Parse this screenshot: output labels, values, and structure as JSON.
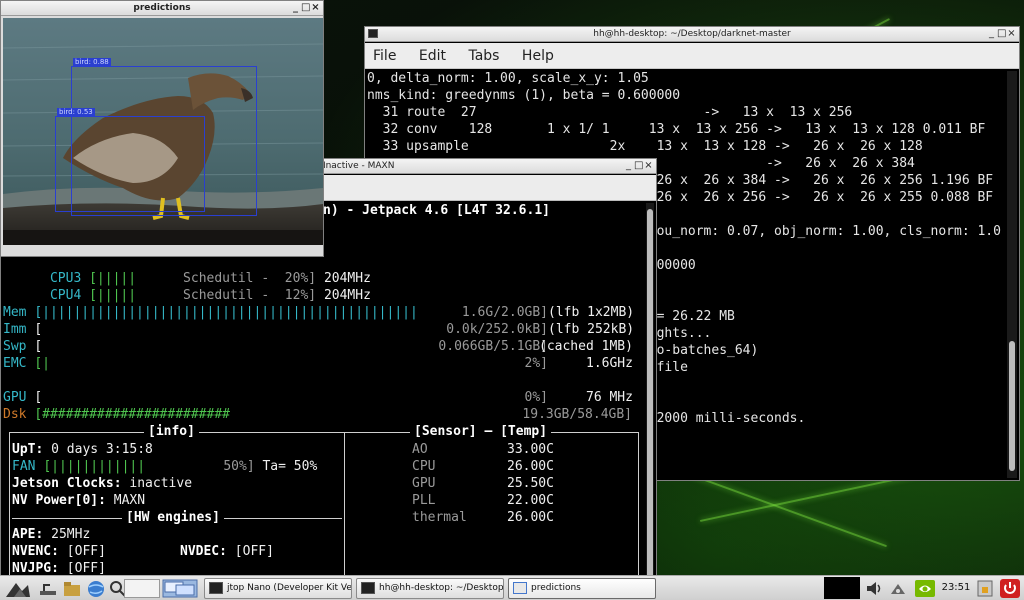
{
  "terminal": {
    "title": "hh@hh-desktop: ~/Desktop/darknet-master",
    "menu": [
      "File",
      "Edit",
      "Tabs",
      "Help"
    ],
    "lines": [
      "0, delta_norm: 1.00, scale_x_y: 1.05",
      "nms_kind: greedynms (1), beta = 0.600000",
      "  31 route  27                             ->   13 x  13 x 256",
      "  32 conv    128       1 x 1/ 1     13 x  13 x 256 ->   13 x  13 x 128 0.011 BF",
      "  33 upsample                  2x    13 x  13 x 128 ->   26 x  26 x 128",
      "                                                   ->   26 x  26 x 384",
      "                                     26 x  26 x 384 ->   26 x  26 x 256 1.196 BF",
      "                                     26 x  26 x 256 ->   26 x  26 x 255 0.088 BF",
      "",
      "                                     ou_norm: 0.07, obj_norm: 1.00, cls_norm: 1.0",
      "",
      "                                     00000",
      "",
      "",
      "                                     = 26.22 MB",
      "                                     ghts...",
      "                                     o-batches_64)",
      "                                     file",
      "",
      "",
      "                                     2000 milli-seconds."
    ]
  },
  "jtop": {
    "title": "jtop Nano (Developer Kit Version) - JC: Inactive - MAXN",
    "title_visible": "Version) - JC: Inactive - MAXN",
    "header": "n) - Jetpack 4.6 [L4T 32.6.1]",
    "cpus": [
      {
        "label": "CPU3",
        "bar": "[|||||",
        "gov": "Schedutil -",
        "pct": "20%]",
        "freq": "204MHz"
      },
      {
        "label": "CPU4",
        "bar": "[|||||",
        "gov": "Schedutil -",
        "pct": "12%]",
        "freq": "204MHz"
      }
    ],
    "mem": [
      {
        "label": "Mem",
        "bar": "[||||||||||||||||||||||||||||||||||||||||||||||||",
        "value": "1.6G/2.0GB]",
        "extra": "(lfb 1x2MB)"
      },
      {
        "label": "Imm",
        "bar": "[",
        "value": "0.0k/252.0kB]",
        "extra": "(lfb 252kB)"
      },
      {
        "label": "Swp",
        "bar": "[",
        "value": "0.066GB/5.1GB]",
        "extra": "(cached 1MB)"
      },
      {
        "label": "EMC",
        "bar": "[|",
        "value": "2%]",
        "extra": "1.6GHz"
      }
    ],
    "gpu": {
      "label": "GPU",
      "bar": "[",
      "value": "0%]",
      "extra": "76 MHz"
    },
    "dsk": {
      "label": "Dsk",
      "bar": "[########################",
      "value": "19.3GB/58.4GB]"
    },
    "info": {
      "title": "[info]",
      "uptime_label": "UpT:",
      "uptime": "0 days 3:15:8",
      "fan_label": "FAN",
      "fan_bar": "[||||||||||||",
      "fan_pct": "50%]",
      "fan_ta": "Ta= 50%",
      "clocks_label": "Jetson Clocks:",
      "clocks": "inactive",
      "nvpower_label": "NV Power[0]:",
      "nvpower": "MAXN"
    },
    "hw": {
      "title": "[HW engines]",
      "ape_label": "APE:",
      "ape": "25MHz",
      "nvenc_label": "NVENC:",
      "nvenc": "[OFF]",
      "nvdec_label": "NVDEC:",
      "nvdec": "[OFF]",
      "nvjpg_label": "NVJPG:",
      "nvjpg": "[OFF]"
    },
    "sensor": {
      "title_sensor": "[Sensor]",
      "title_temp": "[Temp]",
      "rows": [
        {
          "name": "AO",
          "temp": "33.00C"
        },
        {
          "name": "CPU",
          "temp": "26.00C"
        },
        {
          "name": "GPU",
          "temp": "25.50C"
        },
        {
          "name": "PLL",
          "temp": "22.00C"
        },
        {
          "name": "thermal",
          "temp": "26.00C"
        }
      ]
    }
  },
  "predictions": {
    "title": "predictions",
    "detections": [
      {
        "label": "bird: 0.88"
      },
      {
        "label": "bird: 0.53"
      }
    ]
  },
  "taskbar": {
    "tasks": [
      {
        "label": "jtop Nano (Developer Kit Ver..."
      },
      {
        "label": "hh@hh-desktop: ~/Desktop/..."
      },
      {
        "label": "predictions"
      }
    ],
    "clock": "23:51"
  },
  "colors": {
    "jtop_cyan": "#35b8c8",
    "jtop_green": "#4fc44f",
    "detection_blue": "#2a3fd0",
    "wallpaper_green": "#3caa1e"
  }
}
